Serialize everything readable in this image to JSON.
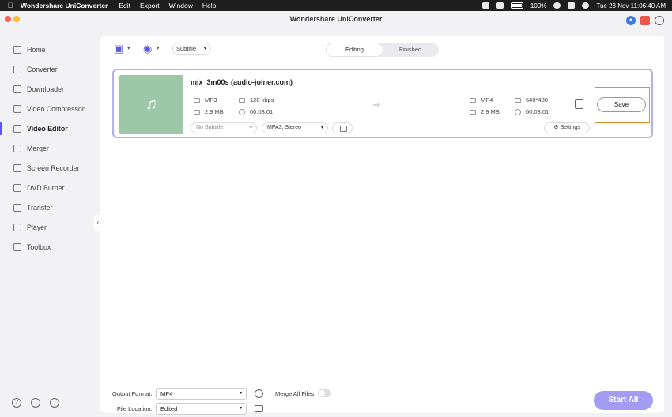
{
  "menubar": {
    "app_name": "Wondershare UniConverter",
    "menus": [
      "Edit",
      "Export",
      "Window",
      "Help"
    ],
    "battery": "100%",
    "datetime": "Tue 23 Nov  11:06:40 AM"
  },
  "window": {
    "title": "Wondershare UniConverter"
  },
  "sidebar": {
    "items": [
      {
        "label": "Home",
        "icon": "home-icon"
      },
      {
        "label": "Converter",
        "icon": "converter-icon"
      },
      {
        "label": "Downloader",
        "icon": "downloader-icon"
      },
      {
        "label": "Video Compressor",
        "icon": "compress-icon"
      },
      {
        "label": "Video Editor",
        "icon": "scissors-icon"
      },
      {
        "label": "Merger",
        "icon": "merger-icon"
      },
      {
        "label": "Screen Recorder",
        "icon": "recorder-icon"
      },
      {
        "label": "DVD Burner",
        "icon": "dvd-icon"
      },
      {
        "label": "Transfer",
        "icon": "transfer-icon"
      },
      {
        "label": "Player",
        "icon": "player-icon"
      },
      {
        "label": "Toolbox",
        "icon": "toolbox-icon"
      }
    ],
    "active": "Video Editor"
  },
  "toolbar": {
    "subtitle_select": "Subtitle",
    "tabs": [
      "Editing",
      "Finished"
    ],
    "active_tab": "Editing"
  },
  "file": {
    "name": "mix_3m00s (audio-joiner.com)",
    "source": {
      "format": "MP3",
      "bitrate": "128 kbps",
      "size": "2.9 MB",
      "duration": "00:03:01"
    },
    "target": {
      "format": "MP4",
      "resolution": "640*480",
      "size": "2.9 MB",
      "duration": "00:03:01"
    },
    "subtitle": "No Subtitle",
    "audio": "MPA3, Stereo",
    "settings_label": "Settings",
    "save_label": "Save"
  },
  "footer": {
    "output_format_label": "Output Format:",
    "output_format": "MP4",
    "merge_label": "Merge All Files",
    "merge_enabled": false,
    "file_location_label": "File Location:",
    "file_location": "Edited",
    "start_all_label": "Start  All"
  },
  "colors": {
    "accent": "#5b57e8",
    "start_button": "#a39cf2",
    "highlight": "#f08a24",
    "thumb": "#9dc8a8"
  }
}
